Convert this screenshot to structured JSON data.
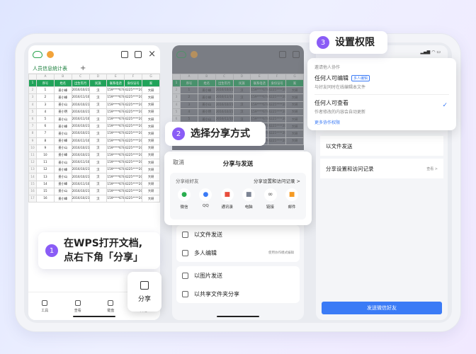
{
  "phone1": {
    "sheet_tab": "人员信息统计表",
    "columns": [
      "A",
      "B",
      "C",
      "D",
      "E",
      "F",
      "G"
    ],
    "header": [
      "序号",
      "姓名",
      "出生年月",
      "民族",
      "联系电话",
      "身份证号",
      "家"
    ],
    "rows": [
      [
        "1",
        "姜小峰",
        "2016/10/21",
        "汉",
        "159****6789",
        "4225****20060225***",
        "大研"
      ],
      [
        "2",
        "姜小峰",
        "2016/11/10",
        "汉",
        "159****6789",
        "4225****20060225***",
        "大研"
      ],
      [
        "3",
        "姜小山",
        "2016/10/21",
        "汉",
        "159****6789",
        "4225****20060225***",
        "大研"
      ],
      [
        "4",
        "姜小明",
        "2016/10/21",
        "汉",
        "159****6789",
        "4225****20060225***",
        "大研"
      ],
      [
        "5",
        "姜小山",
        "2016/11/10",
        "汉",
        "159****6789",
        "4225****20060225***",
        "大研"
      ],
      [
        "6",
        "姜小峰",
        "2016/10/21",
        "汉",
        "159****6789",
        "4225****20060225***",
        "大研"
      ],
      [
        "7",
        "姜小山",
        "2016/10/21",
        "汉",
        "159****6789",
        "4225****20060225***",
        "大研"
      ],
      [
        "8",
        "姜小峰",
        "2016/11/10",
        "汉",
        "159****6789",
        "4225****20060225***",
        "大研"
      ],
      [
        "9",
        "姜小山",
        "2016/10/21",
        "汉",
        "159****6789",
        "4225****20060225***",
        "大研"
      ],
      [
        "10",
        "姜小峰",
        "2016/10/21",
        "汉",
        "159****6789",
        "4225****20060225***",
        "大研"
      ],
      [
        "11",
        "姜小山",
        "2016/11/10",
        "汉",
        "159****6789",
        "4225****20060225***",
        "大研"
      ],
      [
        "12",
        "姜小峰",
        "2016/10/21",
        "汉",
        "159****6789",
        "4225****20060225***",
        "大研"
      ],
      [
        "13",
        "姜小山",
        "2016/10/21",
        "汉",
        "159****6789",
        "4225****20060225***",
        "大研"
      ],
      [
        "14",
        "姜小峰",
        "2016/11/10",
        "汉",
        "159****6789",
        "4225****20060225***",
        "大研"
      ],
      [
        "15",
        "姜小山",
        "2016/10/21",
        "汉",
        "159****6789",
        "4225****20060225***",
        "大研"
      ],
      [
        "16",
        "姜小峰",
        "2016/10/21",
        "汉",
        "159****6789",
        "4225****20060225***",
        "大研"
      ]
    ],
    "bottom_tools": [
      "工具",
      "查看",
      "键盘",
      "开始"
    ]
  },
  "callouts": {
    "step1_num": "1",
    "step1_text_line1": "在WPS打开文档,",
    "step1_text_line2": "点右下角「分享」",
    "step2_num": "2",
    "step2_text": "选择分享方式",
    "step3_num": "3",
    "step3_text": "设置权限"
  },
  "share_float_label": "分享",
  "share_sheet": {
    "cancel": "取消",
    "title": "分享与发送",
    "subtitle_left": "分享给好友",
    "subtitle_right": "分享设置和访问记录 >",
    "apps": [
      {
        "label": "微信",
        "icon": "wechat-icon",
        "glyph": "●",
        "color": "#2aae4f"
      },
      {
        "label": "QQ",
        "icon": "qq-icon",
        "glyph": "●",
        "color": "#3b7bf6"
      },
      {
        "label": "通讯录",
        "icon": "contacts-icon",
        "glyph": "■",
        "color": "#e84d3c"
      },
      {
        "label": "电脑",
        "icon": "computer-icon",
        "glyph": "■",
        "color": "#7c8494"
      },
      {
        "label": "链接",
        "icon": "link-icon",
        "glyph": "∞",
        "color": "#555"
      },
      {
        "label": "邮件",
        "icon": "mail-icon",
        "glyph": "■",
        "color": "#f59a23"
      }
    ]
  },
  "phone2_menu": {
    "send_file": "以文件发送",
    "multi_edit": "多人编辑",
    "multi_edit_note": "使用协作模式编辑",
    "send_image": "以图片发送",
    "share_folder": "以共享文件夹分享"
  },
  "permission": {
    "invite": "邀请他人协作",
    "opt1_title": "任何人可编辑",
    "opt1_badge": "多人编辑",
    "opt1_desc": "与好友同时在线编辑本文件",
    "opt2_title": "任何人可查看",
    "opt2_desc": "作者修改的内容会自动更新",
    "more": "更多协作权限",
    "check": "✓"
  },
  "phone3": {
    "row_send_file": "以文件发送",
    "row_settings": "分享设置和访问记录",
    "row_settings_note": "查看 >",
    "send_button": "发送微信好友"
  },
  "colors": {
    "accent": "#8a5cf6",
    "sheet_green": "#21a35a",
    "link_blue": "#3b7bf6"
  }
}
